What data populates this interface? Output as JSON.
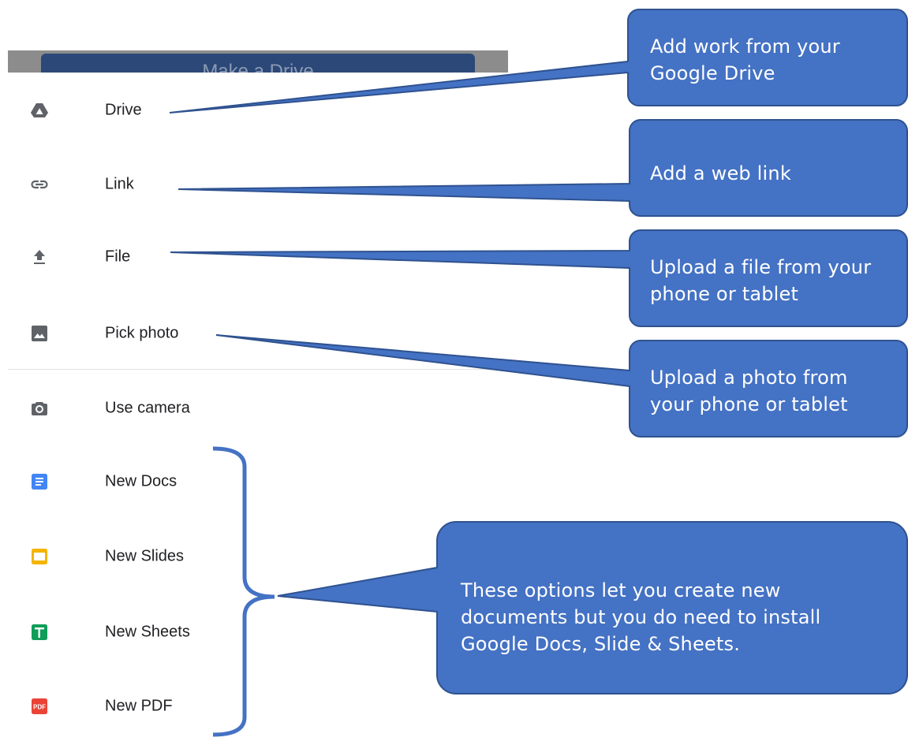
{
  "top_button": {
    "label": "Make a Drive"
  },
  "menu": {
    "items": [
      {
        "label": "Drive",
        "icon": "drive-icon"
      },
      {
        "label": "Link",
        "icon": "link-icon"
      },
      {
        "label": "File",
        "icon": "upload-icon"
      },
      {
        "label": "Pick photo",
        "icon": "photo-icon"
      },
      {
        "label": "Use camera",
        "icon": "camera-icon"
      },
      {
        "label": "New Docs",
        "icon": "docs-icon"
      },
      {
        "label": "New Slides",
        "icon": "slides-icon"
      },
      {
        "label": "New Sheets",
        "icon": "sheets-icon"
      },
      {
        "label": "New PDF",
        "icon": "pdf-icon",
        "icon_text": "PDF"
      }
    ]
  },
  "callouts": {
    "drive": "Add work from your Google Drive",
    "link": "Add a web link",
    "file": "Upload a file from your phone or tablet",
    "photo": "Upload a photo from your phone or tablet",
    "create": "These options let you create new documents but you do need to install Google Docs, Slide & Sheets."
  },
  "colors": {
    "callout_fill": "#4472c4",
    "callout_border": "#2f528f",
    "docs": "#4285f4",
    "slides": "#f4b400",
    "sheets": "#0f9d58",
    "pdf": "#ea4335",
    "icon_gray": "#5f6368"
  }
}
